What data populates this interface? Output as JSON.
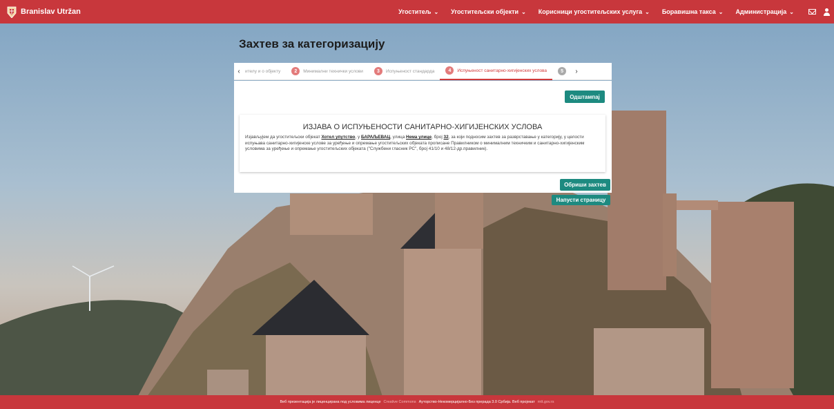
{
  "header": {
    "user_name": "Branislav Utržan",
    "menu": [
      {
        "label": "Угоститељ",
        "icon": "chevron-down-icon"
      },
      {
        "label": "Угоститељски објекти",
        "icon": "chevron-down-icon"
      },
      {
        "label": "Корисници угоститељских услуга",
        "icon": "chevron-down-icon"
      },
      {
        "label": "Боравишна такса",
        "icon": "chevron-down-icon"
      },
      {
        "label": "Администрација",
        "icon": "chevron-down-icon"
      }
    ],
    "chevron": "⌄"
  },
  "page": {
    "title": "Захтев за категоризацију"
  },
  "stepper": {
    "steps": [
      {
        "num": "",
        "label": "ителу и о објекту"
      },
      {
        "num": "2",
        "label": "Минимални технички услови"
      },
      {
        "num": "3",
        "label": "Испуњеност стандарда"
      },
      {
        "num": "4",
        "label": "Испуњеност санитарно-хигијенских услова"
      },
      {
        "num": "5",
        "label": ""
      }
    ]
  },
  "card": {
    "print_label": "Одштампај",
    "declaration_title": "ИЗЈАВА О ИСПУЊЕНОСТИ САНИТАРНО-ХИГИЈЕНСКИХ УСЛОВА",
    "text_1": "Изјављујем да угоститељски објекат ",
    "object_name": "Хотел упутство",
    "text_2": ", у ",
    "city": "БАРАЉЕВАЦ",
    "text_3": ", улица ",
    "street": "Нема улице",
    "text_4": ", број ",
    "number": "32",
    "text_5": ", за који подносим захтев за разврставање у категорију, у целости испуњава санитарно-хигијенске услове за уређење и опремање угоститељских објеката прописане Правилником о минималним техничким и санитарно-хигијенским условима за уређење и опремање угоститељских објеката (\"Службени гласник РС\", број 41/10 и 48/12-др.правилник)."
  },
  "actions": {
    "delete_label": "Обриши захтев",
    "leave_label": "Напусти страницу"
  },
  "footer": {
    "text_1": "Веб презентација је лиценцирана под условима лиценце",
    "link_1": "Creative Commons",
    "text_2": "Ауторство-Некомерцијално-Без прерада 3.0 Србија. Веб пројекат",
    "link_2": "mtt.gov.rs"
  },
  "colors": {
    "brand_red": "#c8373c",
    "accent_teal": "#1d8a80",
    "active_step": "#d23a3a"
  }
}
